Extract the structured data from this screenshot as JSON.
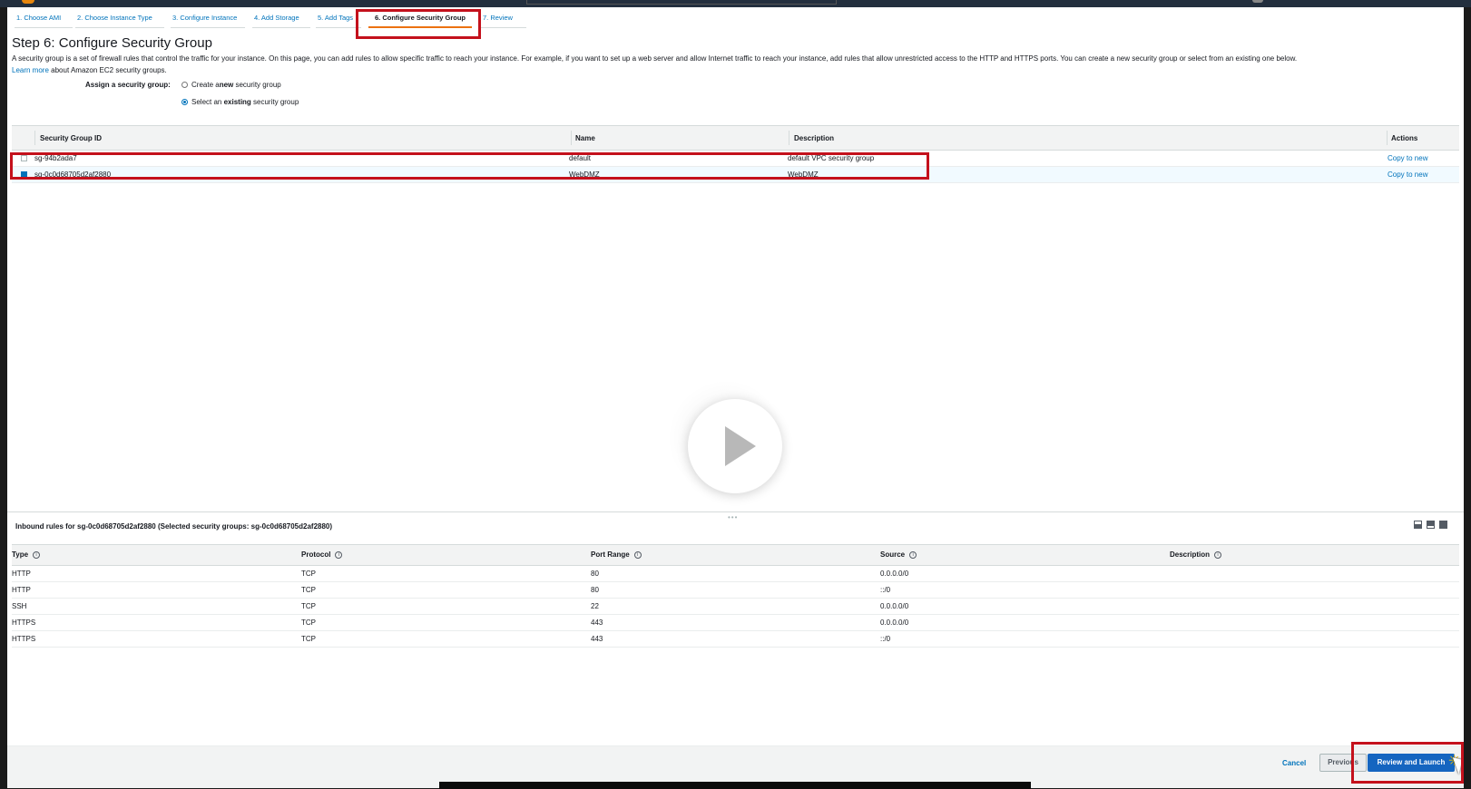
{
  "wizard": {
    "steps": [
      {
        "label": "1. Choose AMI"
      },
      {
        "label": "2. Choose Instance Type"
      },
      {
        "label": "3. Configure Instance"
      },
      {
        "label": "4. Add Storage"
      },
      {
        "label": "5. Add Tags"
      },
      {
        "label": "6. Configure Security Group"
      },
      {
        "label": "7. Review"
      }
    ],
    "active_step": 6
  },
  "page": {
    "title": "Step 6: Configure Security Group",
    "intro": "A security group is a set of firewall rules that control the traffic for your instance. On this page, you can add rules to allow specific traffic to reach your instance. For example, if you want to set up a web server and allow Internet traffic to reach your instance, add rules that allow unrestricted access to the HTTP and HTTPS ports. You can create a new security group or select from an existing one below.",
    "learn_more": "Learn more",
    "learn_more_suffix": "about Amazon EC2 security groups."
  },
  "assign": {
    "label": "Assign a security group:",
    "option_new": {
      "prefix": "Create a ",
      "bold": "new",
      "suffix": " security group",
      "selected": false
    },
    "option_existing": {
      "prefix": "Select an ",
      "bold": "existing",
      "suffix": " security group",
      "selected": true
    }
  },
  "sg_table": {
    "columns": {
      "id": "Security Group ID",
      "name": "Name",
      "description": "Description",
      "actions": "Actions"
    },
    "rows": [
      {
        "id": "sg-94b2ada7",
        "name": "default",
        "description": "default VPC security group",
        "action": "Copy to new",
        "selected": false
      },
      {
        "id": "sg-0c0d68705d2af2880",
        "name": "WebDMZ",
        "description": "WebDMZ",
        "action": "Copy to new",
        "selected": true
      }
    ]
  },
  "inbound": {
    "title": "Inbound rules for sg-0c0d68705d2af2880 (Selected security groups: sg-0c0d68705d2af2880)",
    "columns": {
      "type": "Type",
      "protocol": "Protocol",
      "port_range": "Port Range",
      "source": "Source",
      "description": "Description"
    },
    "rows": [
      {
        "type": "HTTP",
        "protocol": "TCP",
        "port": "80",
        "source": "0.0.0.0/0"
      },
      {
        "type": "HTTP",
        "protocol": "TCP",
        "port": "80",
        "source": "::/0"
      },
      {
        "type": "SSH",
        "protocol": "TCP",
        "port": "22",
        "source": "0.0.0.0/0"
      },
      {
        "type": "HTTPS",
        "protocol": "TCP",
        "port": "443",
        "source": "0.0.0.0/0"
      },
      {
        "type": "HTTPS",
        "protocol": "TCP",
        "port": "443",
        "source": "::/0"
      }
    ]
  },
  "footer": {
    "cancel": "Cancel",
    "previous": "Previous",
    "review_launch": "Review and Launch"
  },
  "colors": {
    "link": "#0073bb",
    "accent": "#ec7211",
    "highlight_box": "#c4111c",
    "primary_button": "#1565c0"
  },
  "icons": [
    "info-icon",
    "play-icon",
    "cursor-icon",
    "layout-icon"
  ]
}
